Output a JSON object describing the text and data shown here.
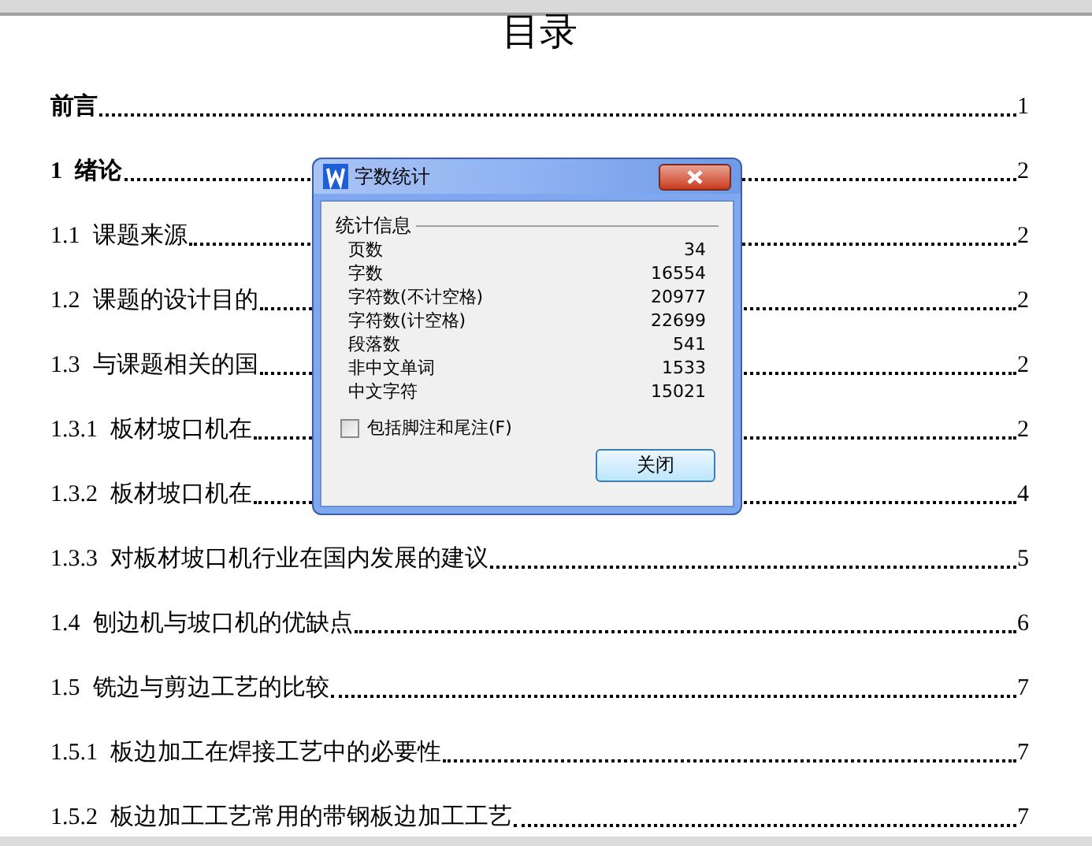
{
  "document": {
    "title": "目录",
    "entries": [
      {
        "title": "前言",
        "page": "1",
        "bold": true
      },
      {
        "number": "1",
        "title": "绪论",
        "page": "2",
        "bold": true
      },
      {
        "number": "1.1",
        "title": "课题来源",
        "page": "2",
        "bold": false
      },
      {
        "number": "1.2",
        "title": "课题的设计目的",
        "page": "2",
        "bold": false
      },
      {
        "number": "1.3",
        "title": "与课题相关的国",
        "page": "2",
        "bold": false
      },
      {
        "number": "1.3.1",
        "title": "板材坡口机在",
        "page": "2",
        "bold": false
      },
      {
        "number": "1.3.2",
        "title": "板材坡口机在",
        "page": "4",
        "bold": false
      },
      {
        "number": "1.3.3",
        "title": "对板材坡口机行业在国内发展的建议",
        "page": "5",
        "bold": false
      },
      {
        "number": "1.4",
        "title": "刨边机与坡口机的优缺点",
        "page": "6",
        "bold": false
      },
      {
        "number": "1.5",
        "title": "铣边与剪边工艺的比较",
        "page": "7",
        "bold": false
      },
      {
        "number": "1.5.1",
        "title": "板边加工在焊接工艺中的必要性",
        "page": "7",
        "bold": false
      },
      {
        "number": "1.5.2",
        "title": "板边加工工艺常用的带钢板边加工工艺",
        "page": "7",
        "bold": false
      }
    ]
  },
  "dialog": {
    "title": "字数统计",
    "section": "统计信息",
    "stats": [
      {
        "label": "页数",
        "value": "34"
      },
      {
        "label": "字数",
        "value": "16554"
      },
      {
        "label": "字符数(不计空格)",
        "value": "20977"
      },
      {
        "label": "字符数(计空格)",
        "value": "22699"
      },
      {
        "label": "段落数",
        "value": "541"
      },
      {
        "label": "非中文单词",
        "value": "1533"
      },
      {
        "label": "中文字符",
        "value": "15021"
      }
    ],
    "checkbox": {
      "label": "包括脚注和尾注(F)",
      "checked": false
    },
    "close_button": "关闭"
  }
}
